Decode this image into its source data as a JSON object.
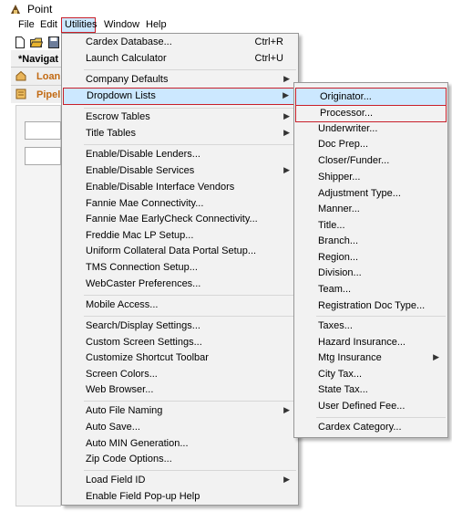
{
  "app": {
    "title": "Point"
  },
  "menubar": {
    "items": [
      "File",
      "Edit",
      "Utilities",
      "Window",
      "Help"
    ]
  },
  "toolbar": {
    "icons": [
      "new-icon",
      "open-icon",
      "save-icon"
    ]
  },
  "navigator": {
    "label": "*Navigat"
  },
  "rows": {
    "loan": "Loan",
    "pipeline": "Pipel"
  },
  "utilities_menu": {
    "cardex": "Cardex Database...",
    "cardex_sc": "Ctrl+R",
    "calc": "Launch Calculator",
    "calc_sc": "Ctrl+U",
    "company": "Company Defaults",
    "dropdown": "Dropdown Lists",
    "escrow": "Escrow Tables",
    "title_tables": "Title Tables",
    "lenders": "Enable/Disable Lenders...",
    "services": "Enable/Disable Services",
    "vendors": "Enable/Disable Interface Vendors",
    "fannie": "Fannie Mae Connectivity...",
    "fannie_ec": "Fannie Mae EarlyCheck Connectivity...",
    "freddie": "Freddie Mac LP Setup...",
    "ucdp": "Uniform Collateral Data Portal Setup...",
    "tms": "TMS Connection Setup...",
    "webcaster": "WebCaster Preferences...",
    "mobile": "Mobile Access...",
    "search": "Search/Display Settings...",
    "custom_screen": "Custom Screen Settings...",
    "custom_toolbar": "Customize Shortcut Toolbar",
    "colors": "Screen Colors...",
    "browser": "Web Browser...",
    "auto_naming": "Auto File Naming",
    "auto_save": "Auto Save...",
    "auto_min": "Auto MIN Generation...",
    "zip": "Zip Code Options...",
    "load_field": "Load Field ID",
    "popup": "Enable Field Pop-up Help"
  },
  "dropdown_menu": {
    "originator": "Originator...",
    "processor": "Processor...",
    "underwriter": "Underwriter...",
    "docprep": "Doc Prep...",
    "closer": "Closer/Funder...",
    "shipper": "Shipper...",
    "adjustment": "Adjustment Type...",
    "manner": "Manner...",
    "title": "Title...",
    "branch": "Branch...",
    "region": "Region...",
    "division": "Division...",
    "team": "Team...",
    "regdoc": "Registration Doc Type...",
    "taxes": "Taxes...",
    "hazard": "Hazard Insurance...",
    "mtg": "Mtg Insurance",
    "city": "City Tax...",
    "state": "State Tax...",
    "udf": "User Defined Fee...",
    "cardex_cat": "Cardex Category..."
  },
  "colors": {
    "highlight": "#cce8ff",
    "highlight_border": "#c8202a",
    "menu_bg": "#f2f2f2",
    "row_text": "#c26a13"
  }
}
